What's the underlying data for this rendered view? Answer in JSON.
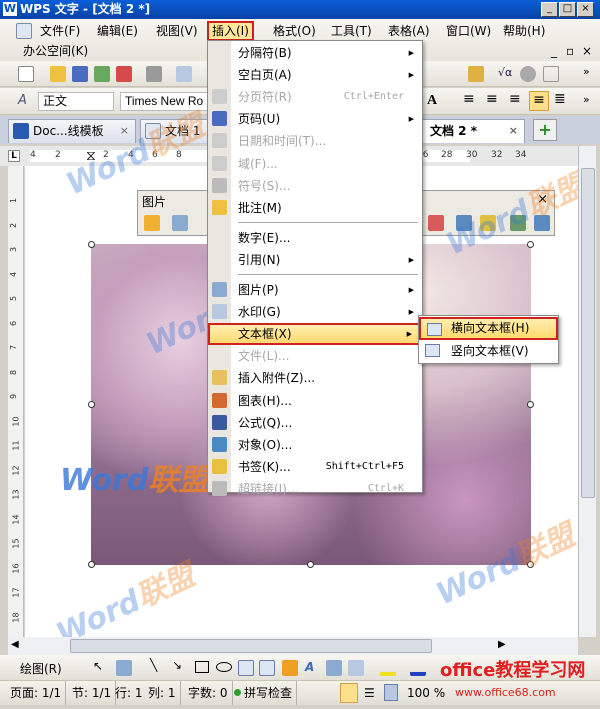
{
  "window": {
    "title": "WPS 文字 - [文档 2 *]",
    "logo": "W",
    "controls": [
      "_",
      "□",
      "×"
    ]
  },
  "menubar": {
    "items": [
      "文件(F)",
      "编辑(E)",
      "视图(V)",
      "插入(I)",
      "格式(O)",
      "工具(T)",
      "表格(A)",
      "窗口(W)",
      "帮助(H)"
    ],
    "active": "插入(I)",
    "second_row": "办公空间(K)",
    "doc_controls": [
      "_",
      "▫",
      "×"
    ]
  },
  "format_toolbar": {
    "style": "正文",
    "font": "Times New Ro"
  },
  "tabs": [
    {
      "label": "Doc...线模板"
    },
    {
      "label": "文档 1"
    },
    {
      "label": "文档 2 *",
      "active": true
    }
  ],
  "ruler": {
    "ticks": [
      "4",
      "2",
      "2",
      "4",
      "6",
      "8",
      "24",
      "26",
      "28",
      "30",
      "32",
      "34"
    ]
  },
  "vruler": {
    "ticks": [
      "1",
      "2",
      "3",
      "4",
      "5",
      "6",
      "7",
      "8",
      "9",
      "10",
      "11",
      "12",
      "13",
      "14",
      "15",
      "16",
      "17",
      "18",
      "19"
    ]
  },
  "picture_toolbar": {
    "title": "图片",
    "close": "×"
  },
  "insert_menu": {
    "items": [
      {
        "label": "分隔符(B)",
        "submenu": true,
        "icon": ""
      },
      {
        "label": "空白页(A)",
        "submenu": true,
        "icon": ""
      },
      {
        "label": "分页符(R)",
        "shortcut": "Ctrl+Enter",
        "disabled": true,
        "icon": "page-break-icon"
      },
      {
        "label": "页码(U)",
        "submenu": true,
        "icon": "page-number-icon"
      },
      {
        "label": "日期和时间(T)...",
        "disabled": true,
        "icon": "datetime-icon"
      },
      {
        "label": "域(F)...",
        "disabled": true,
        "icon": "field-icon"
      },
      {
        "label": "符号(S)...",
        "disabled": true,
        "icon": "omega-icon"
      },
      {
        "label": "批注(M)",
        "icon": "comment-icon"
      },
      {
        "label": "数字(E)...",
        "icon": "",
        "sep_before": true
      },
      {
        "label": "引用(N)",
        "submenu": true,
        "icon": ""
      },
      {
        "label": "图片(P)",
        "submenu": true,
        "icon": "picture-icon",
        "sep_before": true
      },
      {
        "label": "水印(G)",
        "submenu": true,
        "icon": "watermark-icon"
      },
      {
        "label": "文本框(X)",
        "submenu": true,
        "highlighted": true,
        "icon": ""
      },
      {
        "label": "文件(L)...",
        "disabled": true,
        "icon": ""
      },
      {
        "label": "插入附件(Z)...",
        "icon": "attachment-icon"
      },
      {
        "label": "图表(H)...",
        "icon": "chart-icon"
      },
      {
        "label": "公式(Q)...",
        "icon": "formula-icon"
      },
      {
        "label": "对象(O)...",
        "icon": "object-icon"
      },
      {
        "label": "书签(K)...",
        "shortcut": "Shift+Ctrl+F5",
        "icon": "bookmark-icon"
      },
      {
        "label": "超链接(I)...",
        "shortcut": "Ctrl+K",
        "disabled": true,
        "icon": "hyperlink-icon"
      }
    ]
  },
  "textbox_submenu": {
    "items": [
      {
        "label": "横向文本框(H)",
        "highlighted": true
      },
      {
        "label": "竖向文本框(V)"
      }
    ]
  },
  "draw_toolbar": {
    "label": "绘图(R)"
  },
  "status": {
    "page": "页面: 1/1",
    "section": "节: 1/1",
    "row": "行: 1",
    "col": "列: 1",
    "words": "字数: 0",
    "spell": "拼写检查",
    "zoom": "100 %"
  },
  "watermarks": {
    "brand": "Word",
    "brand2": "联盟",
    "site_title": "office教程学习网",
    "site_url": "www.office68.com"
  },
  "colors": {
    "highlight_border": "#d02020",
    "highlight_fill": "#ffd970",
    "title_bar": "#0a5fd6"
  }
}
